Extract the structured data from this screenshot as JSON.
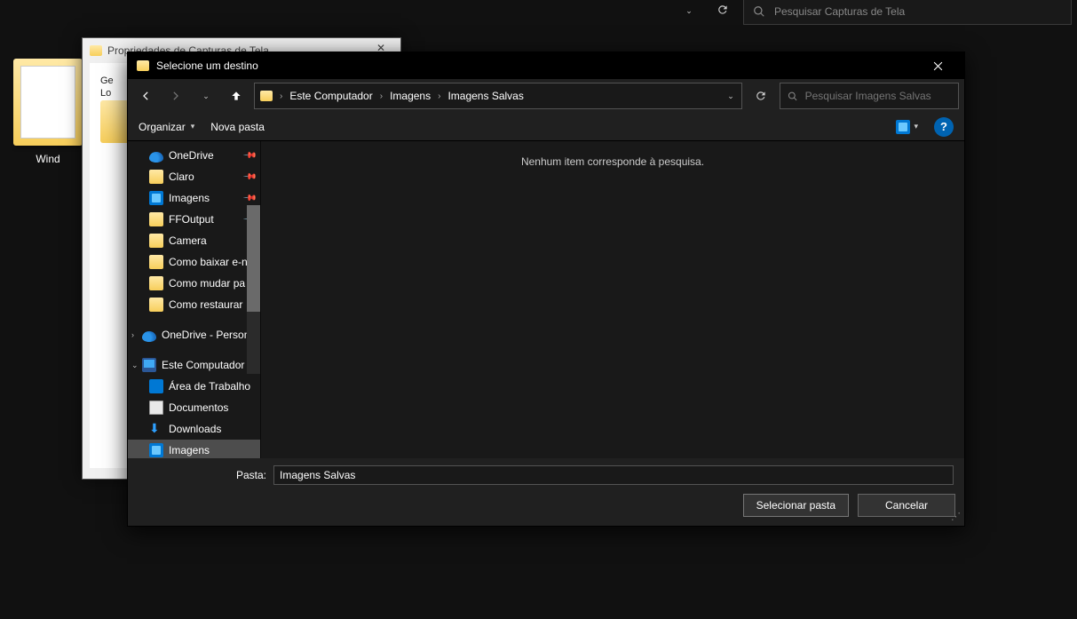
{
  "background": {
    "search_placeholder": "Pesquisar Capturas de Tela",
    "properties_title": "Propriedades de Capturas de Tela",
    "properties_tab1": "Ge",
    "properties_tab2": "Lo",
    "desktop_item_label": "Wind"
  },
  "dialog": {
    "title": "Selecione um destino",
    "breadcrumb": [
      "Este Computador",
      "Imagens",
      "Imagens Salvas"
    ],
    "search_placeholder": "Pesquisar Imagens Salvas",
    "organize_label": "Organizar",
    "new_folder_label": "Nova pasta",
    "empty_message": "Nenhum item corresponde à pesquisa.",
    "folder_label": "Pasta:",
    "folder_value": "Imagens Salvas",
    "select_button": "Selecionar pasta",
    "cancel_button": "Cancelar"
  },
  "sidebar": {
    "items": [
      {
        "label": "OneDrive",
        "icon": "onedrive",
        "pinned": true
      },
      {
        "label": "Claro",
        "icon": "folder",
        "pinned": true
      },
      {
        "label": "Imagens",
        "icon": "images",
        "pinned": true
      },
      {
        "label": "FFOutput",
        "icon": "folder",
        "pinned": true
      },
      {
        "label": "Camera",
        "icon": "folder"
      },
      {
        "label": "Como baixar e-n",
        "icon": "folder"
      },
      {
        "label": "Como mudar pa",
        "icon": "folder"
      },
      {
        "label": "Como restaurar",
        "icon": "folder"
      }
    ],
    "onedrive_personal": "OneDrive - Person",
    "este_computador": "Este Computador",
    "pc_children": [
      {
        "label": "Área de Trabalho",
        "icon": "desktop"
      },
      {
        "label": "Documentos",
        "icon": "doc"
      },
      {
        "label": "Downloads",
        "icon": "download"
      },
      {
        "label": "Imagens",
        "icon": "images",
        "selected": true
      }
    ]
  }
}
